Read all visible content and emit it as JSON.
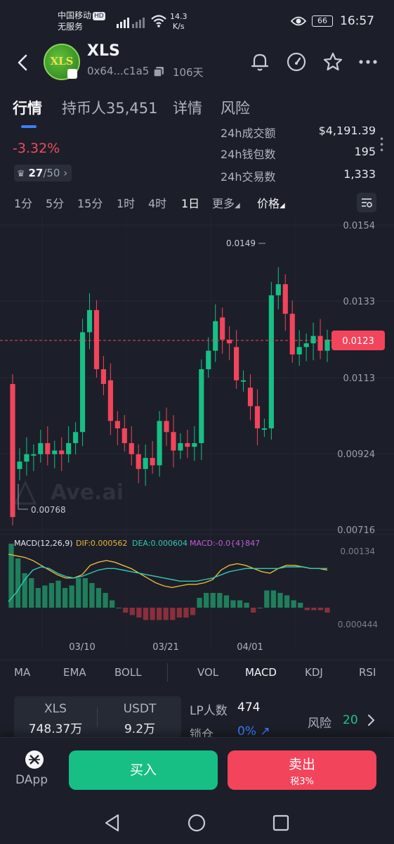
{
  "status_bar": {
    "carrier": "中国移动",
    "hd": "HD",
    "service": "无服务",
    "net_speed_value": "14.3",
    "net_speed_unit": "K/s",
    "battery": "66",
    "time": "16:57"
  },
  "header": {
    "logo_text": "XLS",
    "symbol": "XLS",
    "address": "0x64...c1a5",
    "age": "106天",
    "icons": [
      "bell-icon",
      "gauge-icon",
      "star-icon",
      "more-icon"
    ]
  },
  "tabs": [
    {
      "label": "行情",
      "active": true
    },
    {
      "label": "持币人35,451",
      "active": false
    },
    {
      "label": "详情",
      "active": false
    },
    {
      "label": "风险",
      "active": false
    }
  ],
  "stats": {
    "price_change": "-3.32%",
    "rank": "27",
    "rank_total": "/50",
    "rows": [
      {
        "label": "24h成交额",
        "value": "$4,191.39"
      },
      {
        "label": "24h钱包数",
        "value": "195"
      },
      {
        "label": "24h交易数",
        "value": "1,333"
      }
    ]
  },
  "timeframes": [
    {
      "label": "1分",
      "active": false
    },
    {
      "label": "5分",
      "active": false
    },
    {
      "label": "15分",
      "active": false
    },
    {
      "label": "1时",
      "active": false
    },
    {
      "label": "4时",
      "active": false
    },
    {
      "label": "1日",
      "active": true
    },
    {
      "label": "更多",
      "active": false,
      "dropdown": true
    },
    {
      "label": "价格",
      "active": true,
      "dropdown": true
    }
  ],
  "chart_data": {
    "type": "candlestick",
    "y_axis_labels": [
      "0.0154",
      "0.0133",
      "0.0113",
      "0.00924",
      "0.00716"
    ],
    "ylim": [
      0.00716,
      0.0154
    ],
    "current_price": "0.0123",
    "high_label": "0.0149",
    "low_label": "0.00768",
    "watermark": "Ave.ai",
    "x_labels": [
      "03/10",
      "03/21",
      "04/01"
    ],
    "candles": [
      [
        0.0111,
        0.0075
      ],
      [
        0.0088,
        0.009
      ],
      [
        0.009,
        0.0092
      ],
      [
        0.0092,
        0.0092
      ],
      [
        0.0092,
        0.0095
      ],
      [
        0.0095,
        0.0092
      ],
      [
        0.0092,
        0.0093
      ],
      [
        0.0093,
        0.0092
      ],
      [
        0.0092,
        0.0095
      ],
      [
        0.0095,
        0.0098
      ],
      [
        0.0098,
        0.0125
      ],
      [
        0.0125,
        0.0131
      ],
      [
        0.0131,
        0.0115
      ],
      [
        0.0115,
        0.0111
      ],
      [
        0.0112,
        0.0101
      ],
      [
        0.0101,
        0.0099
      ],
      [
        0.0099,
        0.0095
      ],
      [
        0.0095,
        0.0092
      ],
      [
        0.0092,
        0.0088
      ],
      [
        0.0088,
        0.0091
      ],
      [
        0.0091,
        0.0089
      ],
      [
        0.0089,
        0.0101
      ],
      [
        0.0101,
        0.0098
      ],
      [
        0.0098,
        0.0093
      ],
      [
        0.0093,
        0.0095
      ],
      [
        0.0095,
        0.0094
      ],
      [
        0.0094,
        0.0095
      ],
      [
        0.0095,
        0.0115
      ],
      [
        0.0115,
        0.012
      ],
      [
        0.012,
        0.0128
      ],
      [
        0.0129,
        0.0123
      ],
      [
        0.0123,
        0.0122
      ],
      [
        0.0121,
        0.0112
      ],
      [
        0.0112,
        0.0112
      ],
      [
        0.011,
        0.0105
      ],
      [
        0.0105,
        0.0099
      ],
      [
        0.0099,
        0.0099
      ],
      [
        0.0099,
        0.0135
      ],
      [
        0.0135,
        0.0138
      ],
      [
        0.0138,
        0.013
      ],
      [
        0.013,
        0.0119
      ],
      [
        0.0119,
        0.0121
      ],
      [
        0.0121,
        0.0122
      ],
      [
        0.0122,
        0.0124
      ],
      [
        0.0124,
        0.012
      ],
      [
        0.012,
        0.0123
      ]
    ],
    "macd": {
      "label": "MACD(12,26,9)",
      "dif": "DIF:0.000562",
      "dea": "DEA:0.000604",
      "macd": "MACD:-0.0{4}847",
      "y_labels": [
        "0.00134",
        "0.000444"
      ],
      "histogram": [
        1.3,
        1.0,
        0.7,
        0.6,
        0.4,
        0.45,
        0.5,
        0.55,
        0.4,
        0.45,
        0.6,
        0.6,
        0.5,
        0.4,
        0.3,
        0.15,
        0.0,
        -0.1,
        -0.15,
        -0.2,
        -0.25,
        -0.25,
        -0.25,
        -0.25,
        -0.25,
        -0.2,
        -0.2,
        -0.15,
        0.2,
        0.3,
        0.3,
        0.3,
        0.25,
        0.15,
        0.15,
        0.1,
        -0.1,
        0.0,
        0.35,
        0.35,
        0.3,
        0.25,
        0.15,
        0.1,
        -0.05,
        -0.05,
        -0.05,
        -0.1
      ],
      "dif_line": [
        0.8,
        0.75,
        0.7,
        0.6,
        0.45,
        0.3,
        0.15,
        0.05,
        0.05,
        0.15,
        0.45,
        0.55,
        0.6,
        0.55,
        0.45,
        0.35,
        0.2,
        0.05,
        -0.1,
        -0.2,
        -0.25,
        -0.2,
        -0.15,
        -0.15,
        -0.1,
        0.0,
        0.3,
        0.45,
        0.5,
        0.45,
        0.35,
        0.25,
        0.2,
        0.35,
        0.45,
        0.45,
        0.4,
        0.35,
        0.35,
        0.3
      ],
      "dea_line": [
        -0.7,
        -0.4,
        0.0,
        0.3,
        0.4,
        0.35,
        0.2,
        0.1,
        0.05,
        0.1,
        0.2,
        0.3,
        0.35,
        0.35,
        0.3,
        0.25,
        0.2,
        0.15,
        0.1,
        0.05,
        0.0,
        -0.05,
        -0.05,
        -0.05,
        0.0,
        0.05,
        0.15,
        0.25,
        0.3,
        0.35,
        0.35,
        0.35,
        0.35,
        0.35,
        0.4,
        0.4,
        0.4,
        0.35,
        0.35,
        0.35
      ]
    }
  },
  "indicators": [
    {
      "label": "MA",
      "active": false
    },
    {
      "label": "EMA",
      "active": false
    },
    {
      "label": "BOLL",
      "active": false
    },
    {
      "label": "VOL",
      "active": false
    },
    {
      "label": "MACD",
      "active": true
    },
    {
      "label": "KDJ",
      "active": false
    },
    {
      "label": "RSI",
      "active": false
    }
  ],
  "liquidity": {
    "token_a": "XLS",
    "token_a_amount": "748.37万",
    "token_b": "USDT",
    "token_b_amount": "9.2万",
    "lp_label": "LP人数",
    "lp_value": "474",
    "lock_label": "锁仓",
    "lock_value": "0%",
    "risk_label": "风险",
    "risk_score": "20"
  },
  "actions": {
    "dapp": "DApp",
    "buy": "买入",
    "sell": "卖出",
    "sell_tax": "税3%"
  },
  "colors": {
    "background": "#1c1f29",
    "up": "#17bf85",
    "down": "#f2445b",
    "accent": "#3d7dff",
    "dif": "#e8b73d",
    "dea": "#35c6b5"
  }
}
